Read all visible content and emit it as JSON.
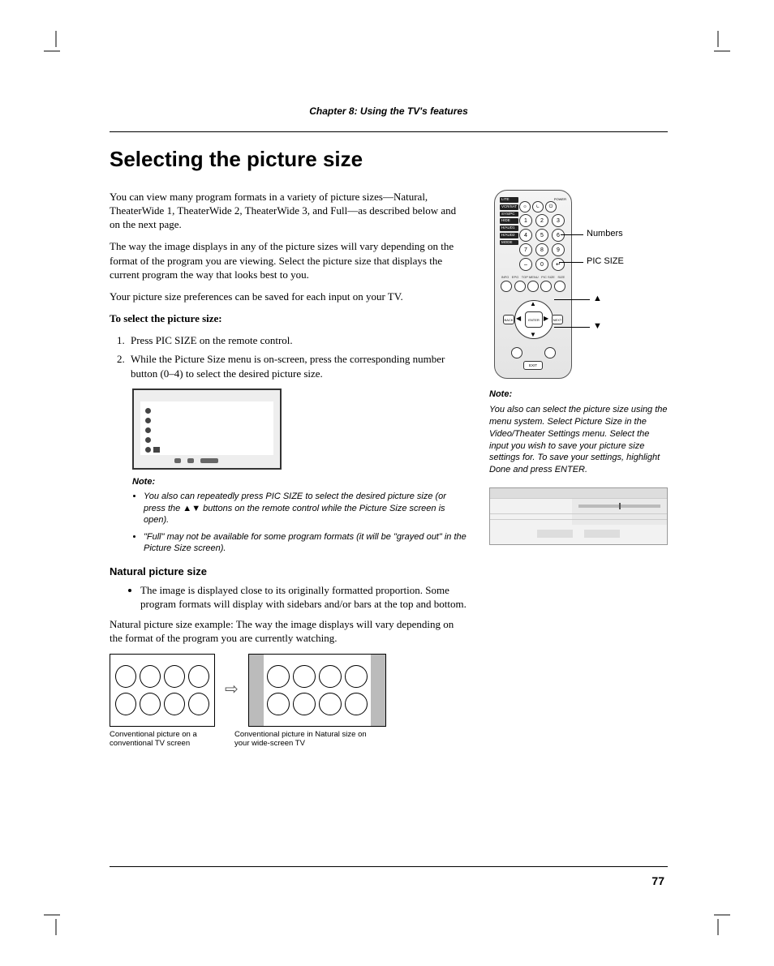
{
  "chapter": "Chapter 8: Using the TV's features",
  "title": "Selecting the picture size",
  "intro1": "You can view many program formats in a variety of picture sizes—Natural, TheaterWide 1, TheaterWide 2, TheaterWide 3, and Full—as described below and on the next page.",
  "intro2": "The way the image displays in any of the picture sizes will vary depending on the format of the program you are viewing. Select the picture size that displays the current program the way that looks best to you.",
  "intro3": "Your picture size preferences can be saved for each input on your TV.",
  "procHead": "To select the picture size:",
  "step1": "Press PIC SIZE on the remote control.",
  "step2": "While the Picture Size menu is on-screen, press the corresponding number button (0–4) to select the desired picture size.",
  "noteLabel": "Note:",
  "noteA": "You also can repeatedly press PIC SIZE to select the desired picture size (or press the ▲▼ buttons on the remote control while the Picture Size screen is open).",
  "noteB": "\"Full\" may not be available for some program formats (it will be \"grayed out\" in the Picture Size screen).",
  "natHead": "Natural picture size",
  "natBullet": "The image is displayed close to its originally formatted proportion. Some program formats will display with sidebars and/or bars at the top and bottom.",
  "natPara": "Natural picture size example: The way the image displays will vary depending on the format of the program you are currently watching.",
  "capA": "Conventional picture on a conventional TV screen",
  "capB": "Conventional picture in Natural size on your wide-screen TV",
  "calloutNumbers": "Numbers",
  "calloutPicSize": "PIC SIZE",
  "calloutUp": "▲",
  "calloutDown": "▼",
  "rNote": "You also can select the picture size using the menu system. Select Picture Size in the Video/Theater Settings menu. Select the input you wish to save your picture size settings for. To save your settings, highlight Done and press ENTER.",
  "pageNumber": "77",
  "remote": {
    "tags": [
      "LITE",
      "VCR/SAT",
      "SYS/PC",
      "HIDE",
      "H/AUD1",
      "H/AUD2",
      "MODE"
    ],
    "power": "POWER",
    "enter": "ENTER",
    "exit": "EXIT",
    "back": "BACK",
    "next": "NEXT",
    "labels": [
      "INFO",
      "EPG",
      "TOP MENU",
      "PIC SIZE",
      "SIZE"
    ]
  }
}
